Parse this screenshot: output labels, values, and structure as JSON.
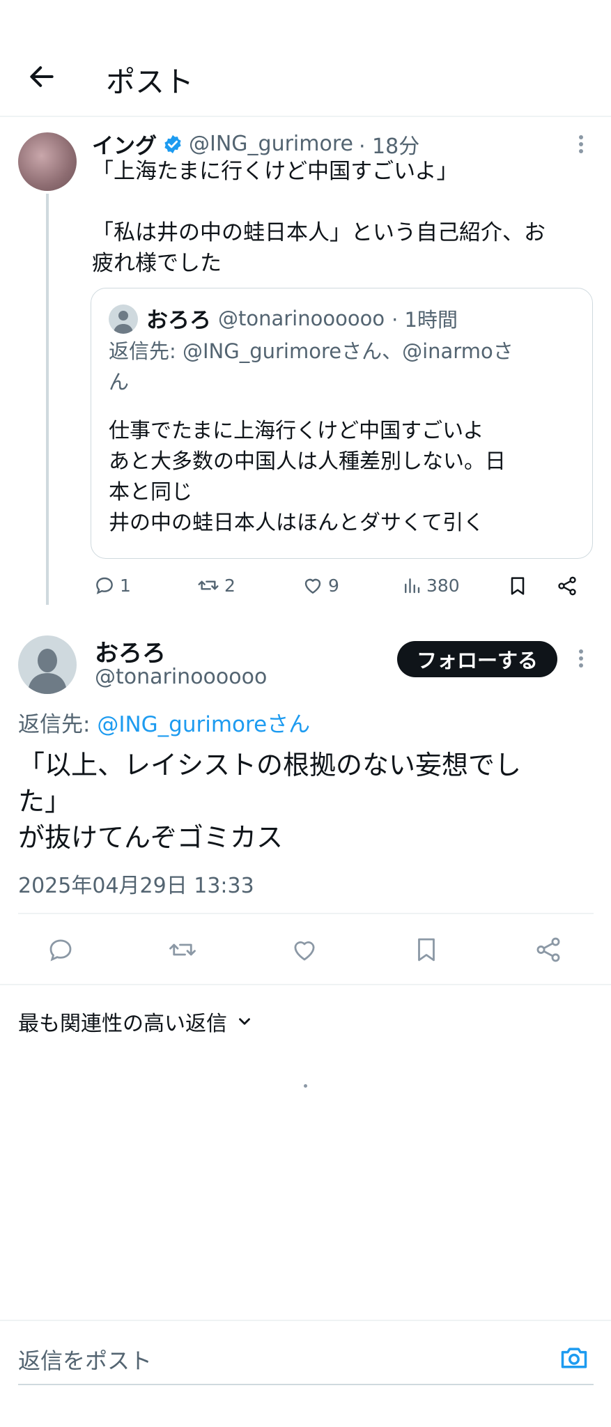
{
  "header": {
    "title": "ポスト"
  },
  "quoted_post": {
    "author_name": "イング",
    "handle": "@ING_gurimore",
    "time": "· 18分",
    "text": "「上海たまに行くけど中国すごいよ」\n\n「私は井の中の蛙日本人」という自己紹介、お\n疲れ様でした",
    "embedded": {
      "author_name": "おろろ",
      "handle": "@tonarinoooooo",
      "time": "· 1時間",
      "reply_line1": "返信先: @ING_gurimoreさん、@inarmoさ",
      "reply_line2": "ん",
      "text": "仕事でたまに上海行くけど中国すごいよ\nあと大多数の中国人は人種差別しない。日\n本と同じ\n井の中の蛙日本人はほんとダサくて引く"
    },
    "stats": {
      "replies": "1",
      "reposts": "2",
      "likes": "9",
      "views": "380"
    }
  },
  "main_post": {
    "author_name": "おろろ",
    "handle": "@tonarinoooooo",
    "follow_label": "フォローする",
    "reply_prefix": "返信先: ",
    "reply_to": "@ING_gurimoreさん",
    "text": "「以上、レイシストの根拠のない妄想でし\nた」\nが抜けてんぞゴミカス",
    "timestamp": "2025年04月29日 13:33"
  },
  "replies_sort": {
    "label": "最も関連性の高い返信"
  },
  "composer": {
    "placeholder": "返信をポスト"
  },
  "colors": {
    "accent": "#1d9bf0",
    "text": "#0f1419",
    "muted": "#536471",
    "border": "#eff3f4"
  }
}
